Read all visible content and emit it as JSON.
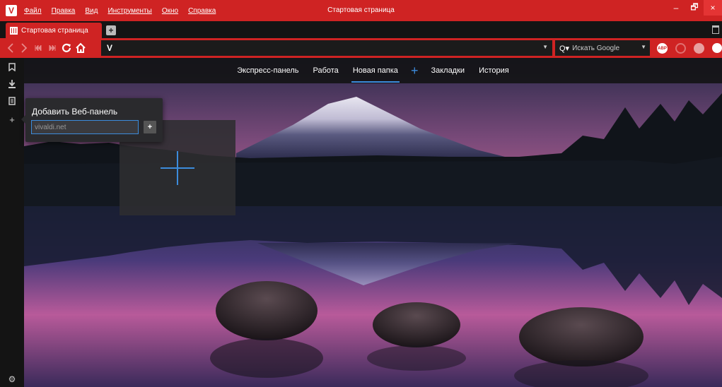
{
  "app": {
    "logo_letter": "V",
    "window_title": "Стартовая страница"
  },
  "menu": [
    "Файл",
    "Правка",
    "Вид",
    "Инструменты",
    "Окно",
    "Справка"
  ],
  "window_controls": {
    "minimize": "–",
    "maximize": "🗗",
    "close": "×"
  },
  "tabs": [
    {
      "title": "Стартовая страница",
      "active": true
    }
  ],
  "tabbar": {
    "new_tab_label": "+"
  },
  "address_bar": {
    "url_value": "V",
    "dropdown_glyph": "▼"
  },
  "search": {
    "icon": "Q▾",
    "placeholder": "Искать Google",
    "dropdown_glyph": "▼"
  },
  "extensions": {
    "abp_label": "ABP"
  },
  "panel_bar": {
    "items": [
      {
        "name": "bookmarks",
        "glyph": "🔖"
      },
      {
        "name": "downloads",
        "glyph": "⬇"
      },
      {
        "name": "notes",
        "glyph": "▤"
      },
      {
        "name": "add-web-panel",
        "glyph": "+"
      }
    ],
    "settings_glyph": "⚙"
  },
  "speed_dial_nav": {
    "tabs": [
      {
        "label": "Экспресс-панель",
        "active": false
      },
      {
        "label": "Работа",
        "active": false
      },
      {
        "label": "Новая папка",
        "active": true
      }
    ],
    "add_glyph": "+",
    "extra_tabs": [
      {
        "label": "Закладки"
      },
      {
        "label": "История"
      }
    ]
  },
  "web_panel_popup": {
    "title": "Добавить Веб-панель",
    "url_placeholder": "vivaldi.net",
    "add_button": "+"
  },
  "colors": {
    "accent": "#cf2323",
    "highlight": "#3c8cdc",
    "dark": "#141414"
  }
}
